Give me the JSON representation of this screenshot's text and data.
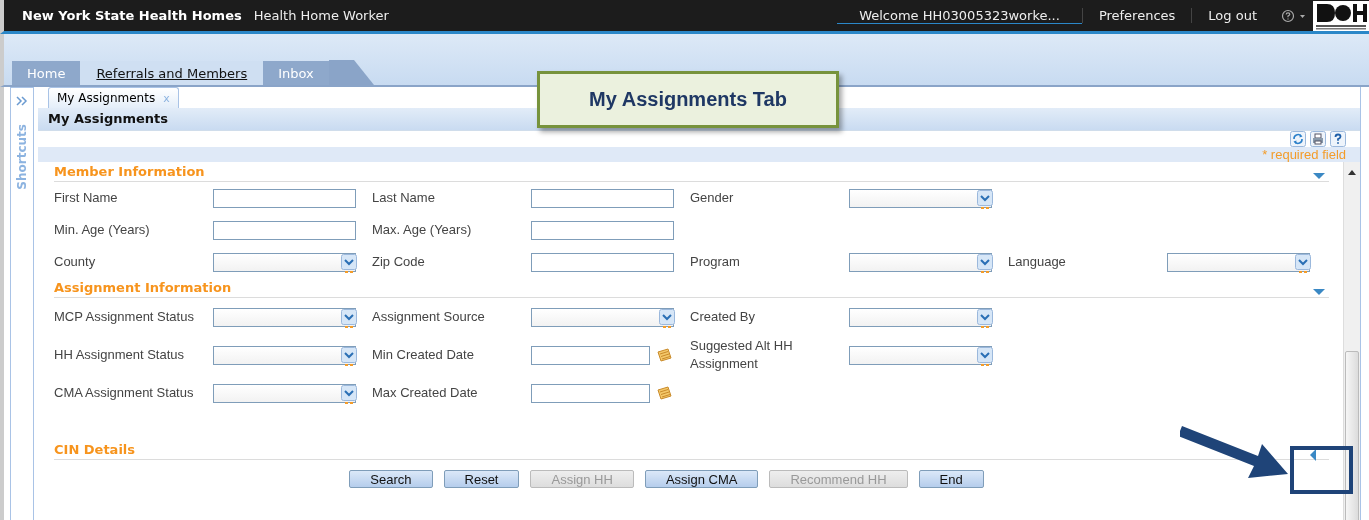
{
  "header": {
    "brand": "New York State Health Homes",
    "role": "Health Home Worker",
    "welcome": "Welcome HH03005323worke...",
    "links": [
      "Preferences",
      "Log out"
    ]
  },
  "tabs": [
    {
      "label": "Home",
      "selected": false
    },
    {
      "label": "Referrals and Members",
      "selected": true
    },
    {
      "label": "Inbox",
      "selected": false
    }
  ],
  "sidebar": {
    "label": "Shortcuts"
  },
  "subtabs": [
    {
      "label": "My Assignments",
      "close": "x",
      "selected": true
    }
  ],
  "panel": {
    "title": "My Assignments",
    "required_note": "* required field"
  },
  "sections": [
    {
      "title": "Member Information",
      "expanded": true,
      "rows": [
        [
          {
            "label": "First Name",
            "kind": "text"
          },
          {
            "label": "Last Name",
            "kind": "text"
          },
          {
            "label": "Gender",
            "kind": "select"
          }
        ],
        [
          {
            "label": "Min. Age (Years)",
            "kind": "text"
          },
          {
            "label": "Max. Age (Years)",
            "kind": "text"
          }
        ],
        [
          {
            "label": "County",
            "kind": "select"
          },
          {
            "label": "Zip Code",
            "kind": "text"
          },
          {
            "label": "Program",
            "kind": "select"
          },
          {
            "label": "Language",
            "kind": "select"
          }
        ]
      ]
    },
    {
      "title": "Assignment Information",
      "expanded": true,
      "rows": [
        [
          {
            "label": "MCP Assignment Status",
            "kind": "select"
          },
          {
            "label": "Assignment Source",
            "kind": "select"
          },
          {
            "label": "Created By",
            "kind": "select"
          }
        ],
        [
          {
            "label": "HH Assignment Status",
            "kind": "select"
          },
          {
            "label": "Min Created Date",
            "kind": "date"
          },
          {
            "label": "Suggested Alt HH Assignment",
            "kind": "select"
          }
        ],
        [
          {
            "label": "CMA Assignment Status",
            "kind": "select"
          },
          {
            "label": "Max Created Date",
            "kind": "date"
          }
        ]
      ]
    },
    {
      "title": "CIN Details",
      "expanded": false
    }
  ],
  "buttons": [
    {
      "label": "Search",
      "disabled": false
    },
    {
      "label": "Reset",
      "disabled": false
    },
    {
      "label": "Assign HH",
      "disabled": true
    },
    {
      "label": "Assign CMA",
      "disabled": false
    },
    {
      "label": "Recommend HH",
      "disabled": true
    },
    {
      "label": "End",
      "disabled": false
    }
  ],
  "callout": {
    "text": "My Assignments Tab"
  }
}
